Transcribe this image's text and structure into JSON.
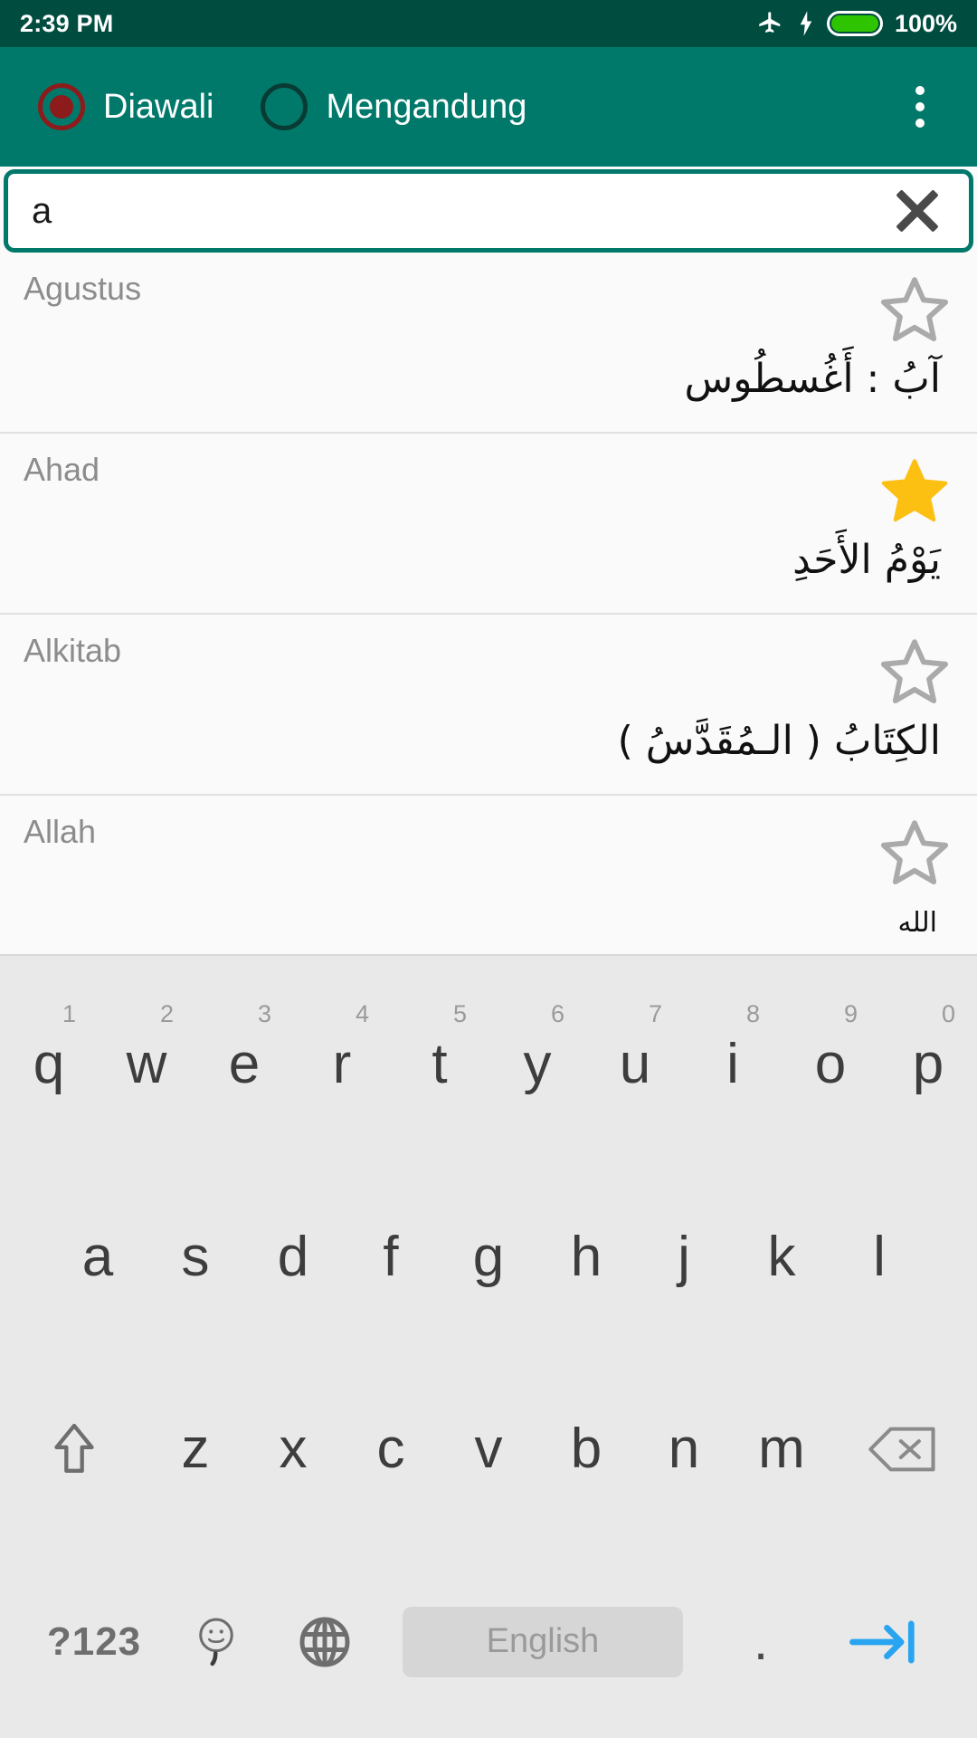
{
  "statusbar": {
    "time": "2:39 PM",
    "battery_percent": "100%",
    "icons": [
      "airplane-mode-icon",
      "charging-bolt-icon",
      "battery-icon"
    ],
    "bg_color": "#004d40"
  },
  "appbar": {
    "bg_color": "#00796b",
    "radio_options": [
      {
        "label": "Diawali",
        "selected": true,
        "accent": "#8d1b1b"
      },
      {
        "label": "Mengandung",
        "selected": false,
        "accent": "#083b33"
      }
    ],
    "overflow_menu": "more-options"
  },
  "search": {
    "value": "a",
    "placeholder": "",
    "clear_label": "clear-text",
    "border_color": "#00796b"
  },
  "results": [
    {
      "title": "Agustus",
      "arabic": "آبُ : أَغُسطُوس",
      "starred": false,
      "arabic_size": "normal"
    },
    {
      "title": "Ahad",
      "arabic": "يَوْمُ الأَحَدِ",
      "starred": true,
      "arabic_size": "normal"
    },
    {
      "title": "Alkitab",
      "arabic": "الكِتَابُ ( الـمُقَدَّسُ )",
      "starred": false,
      "arabic_size": "normal"
    },
    {
      "title": "Allah",
      "arabic": "الله",
      "starred": false,
      "arabic_size": "small"
    }
  ],
  "star_colors": {
    "filled": "#fcc013",
    "empty": "#aaaaaa"
  },
  "keyboard": {
    "bg_color": "#e9e9e9",
    "row1": [
      {
        "letter": "q",
        "num": "1"
      },
      {
        "letter": "w",
        "num": "2"
      },
      {
        "letter": "e",
        "num": "3"
      },
      {
        "letter": "r",
        "num": "4"
      },
      {
        "letter": "t",
        "num": "5"
      },
      {
        "letter": "y",
        "num": "6"
      },
      {
        "letter": "u",
        "num": "7"
      },
      {
        "letter": "i",
        "num": "8"
      },
      {
        "letter": "o",
        "num": "9"
      },
      {
        "letter": "p",
        "num": "0"
      }
    ],
    "row2": [
      {
        "letter": "a"
      },
      {
        "letter": "s"
      },
      {
        "letter": "d"
      },
      {
        "letter": "f"
      },
      {
        "letter": "g"
      },
      {
        "letter": "h"
      },
      {
        "letter": "j"
      },
      {
        "letter": "k"
      },
      {
        "letter": "l"
      }
    ],
    "row3": [
      {
        "letter": "z"
      },
      {
        "letter": "x"
      },
      {
        "letter": "c"
      },
      {
        "letter": "v"
      },
      {
        "letter": "b"
      },
      {
        "letter": "n"
      },
      {
        "letter": "m"
      }
    ],
    "shift_key": "shift-key",
    "backspace_key": "backspace-key",
    "symbols_key": "?123",
    "emoji_key": "emoji-key",
    "globe_key": "language-switch-key",
    "spacebar_label": "English",
    "period_key": ".",
    "enter_key": "next-key",
    "enter_color": "#28a4f0"
  }
}
